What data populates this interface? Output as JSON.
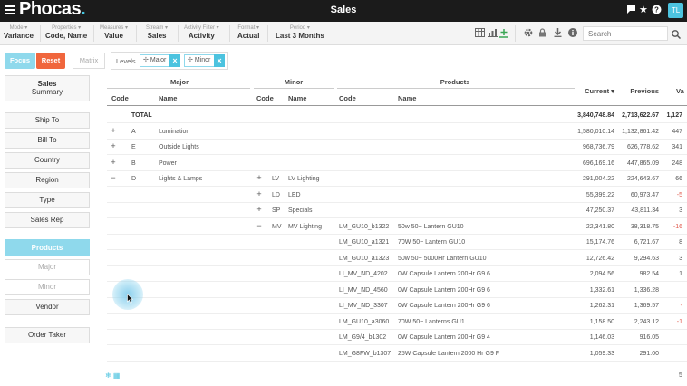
{
  "app": {
    "logo": "Phocas",
    "title": "Sales",
    "avatar": "TL"
  },
  "toolbar": {
    "items": [
      {
        "label": "Mode ▾",
        "value": "Variance"
      },
      {
        "label": "Properties ▾",
        "value": "Code, Name"
      },
      {
        "label": "Measures ▾",
        "value": "Value"
      },
      {
        "label": "Stream ▾",
        "value": "Sales"
      },
      {
        "label": "Activity Filter ▾",
        "value": "Activity"
      },
      {
        "label": "Format ▾",
        "value": "Actual"
      },
      {
        "label": "Period ▾",
        "value": "Last 3 Months"
      }
    ],
    "search_placeholder": "Search"
  },
  "filters": {
    "focus": "Focus",
    "reset": "Reset",
    "matrix": "Matrix",
    "levels_label": "Levels",
    "chips": [
      "Major",
      "Minor"
    ]
  },
  "nav": {
    "summary_title": "Sales",
    "summary_sub": "Summary",
    "items": [
      "Ship To",
      "Bill To",
      "Country",
      "Region",
      "Type",
      "Sales Rep"
    ],
    "products": "Products",
    "product_subs": [
      "Major",
      "Minor",
      "Vendor"
    ],
    "order_taker": "Order Taker"
  },
  "table": {
    "groups": {
      "major": "Major",
      "minor": "Minor",
      "products": "Products"
    },
    "columns": {
      "code": "Code",
      "name": "Name",
      "current": "Current ▾",
      "previous": "Previous",
      "var": "Va"
    },
    "rows": [
      {
        "exp": "",
        "major_code": "TOTAL",
        "major_name": "",
        "minor_exp": "",
        "minor_code": "",
        "minor_name": "",
        "prod_code": "",
        "prod_name": "",
        "current": "3,840,748.84",
        "previous": "2,713,622.67",
        "var": "1,127",
        "bold": true
      },
      {
        "exp": "+",
        "major_code": "A",
        "major_name": "Lumination",
        "minor_exp": "",
        "minor_code": "",
        "minor_name": "",
        "prod_code": "",
        "prod_name": "",
        "current": "1,580,010.14",
        "previous": "1,132,861.42",
        "var": "447"
      },
      {
        "exp": "+",
        "major_code": "E",
        "major_name": "Outside Lights",
        "minor_exp": "",
        "minor_code": "",
        "minor_name": "",
        "prod_code": "",
        "prod_name": "",
        "current": "968,736.79",
        "previous": "626,778.62",
        "var": "341"
      },
      {
        "exp": "+",
        "major_code": "B",
        "major_name": "Power",
        "minor_exp": "",
        "minor_code": "",
        "minor_name": "",
        "prod_code": "",
        "prod_name": "",
        "current": "696,169.16",
        "previous": "447,865.09",
        "var": "248"
      },
      {
        "exp": "−",
        "major_code": "D",
        "major_name": "Lights & Lamps",
        "minor_exp": "+",
        "minor_code": "LV",
        "minor_name": "LV Lighting",
        "prod_code": "",
        "prod_name": "",
        "current": "291,004.22",
        "previous": "224,643.67",
        "var": "66"
      },
      {
        "exp": "",
        "major_code": "",
        "major_name": "",
        "minor_exp": "+",
        "minor_code": "LD",
        "minor_name": "LED",
        "prod_code": "",
        "prod_name": "",
        "current": "55,399.22",
        "previous": "60,973.47",
        "var": "-5",
        "neg": true
      },
      {
        "exp": "",
        "major_code": "",
        "major_name": "",
        "minor_exp": "+",
        "minor_code": "SP",
        "minor_name": "Specials",
        "prod_code": "",
        "prod_name": "",
        "current": "47,250.37",
        "previous": "43,811.34",
        "var": "3"
      },
      {
        "exp": "",
        "major_code": "",
        "major_name": "",
        "minor_exp": "−",
        "minor_code": "MV",
        "minor_name": "MV Lighting",
        "prod_code": "LM_GU10_b1322",
        "prod_name": "50w 50~ Lantern GU10",
        "current": "22,341.80",
        "previous": "38,318.75",
        "var": "-16",
        "neg": true
      },
      {
        "exp": "",
        "major_code": "",
        "major_name": "",
        "minor_exp": "",
        "minor_code": "",
        "minor_name": "",
        "prod_code": "LM_GU10_a1321",
        "prod_name": "70W 50~ Lantern GU10",
        "current": "15,174.76",
        "previous": "6,721.67",
        "var": "8"
      },
      {
        "exp": "",
        "major_code": "",
        "major_name": "",
        "minor_exp": "",
        "minor_code": "",
        "minor_name": "",
        "prod_code": "LM_GU10_a1323",
        "prod_name": "50w 50~ 5000Hr Lantern GU10",
        "current": "12,726.42",
        "previous": "9,294.63",
        "var": "3"
      },
      {
        "exp": "",
        "major_code": "",
        "major_name": "",
        "minor_exp": "",
        "minor_code": "",
        "minor_name": "",
        "prod_code": "LI_MV_ND_4202",
        "prod_name": "0W Capsule Lantern 200Hr G9 6",
        "current": "2,094.56",
        "previous": "982.54",
        "var": "1"
      },
      {
        "exp": "",
        "major_code": "",
        "major_name": "",
        "minor_exp": "",
        "minor_code": "",
        "minor_name": "",
        "prod_code": "LI_MV_ND_4560",
        "prod_name": "0W Capsule Lantern 200Hr G9 6",
        "current": "1,332.61",
        "previous": "1,336.28",
        "var": ""
      },
      {
        "exp": "",
        "major_code": "",
        "major_name": "",
        "minor_exp": "",
        "minor_code": "",
        "minor_name": "",
        "prod_code": "LI_MV_ND_3307",
        "prod_name": "0W Capsule Lantern 200Hr G9 6",
        "current": "1,262.31",
        "previous": "1,369.57",
        "var": "-",
        "neg": true
      },
      {
        "exp": "",
        "major_code": "",
        "major_name": "",
        "minor_exp": "",
        "minor_code": "",
        "minor_name": "",
        "prod_code": "LM_GU10_a3060",
        "prod_name": "70W 50~ Lanterns GU1",
        "current": "1,158.50",
        "previous": "2,243.12",
        "var": "-1",
        "neg": true
      },
      {
        "exp": "",
        "major_code": "",
        "major_name": "",
        "minor_exp": "",
        "minor_code": "",
        "minor_name": "",
        "prod_code": "LM_G9/4_b1302",
        "prod_name": "0W Capsule Lantern 200Hr G9 4",
        "current": "1,146.03",
        "previous": "916.05",
        "var": ""
      },
      {
        "exp": "",
        "major_code": "",
        "major_name": "",
        "minor_exp": "",
        "minor_code": "",
        "minor_name": "",
        "prod_code": "LM_G8FW_b1307",
        "prod_name": "25W Capsule Lantern 2000 Hr G9 F",
        "current": "1,059.33",
        "previous": "291.00",
        "var": ""
      }
    ]
  },
  "footer": {
    "icons": "❄ ▦",
    "count": "5"
  }
}
